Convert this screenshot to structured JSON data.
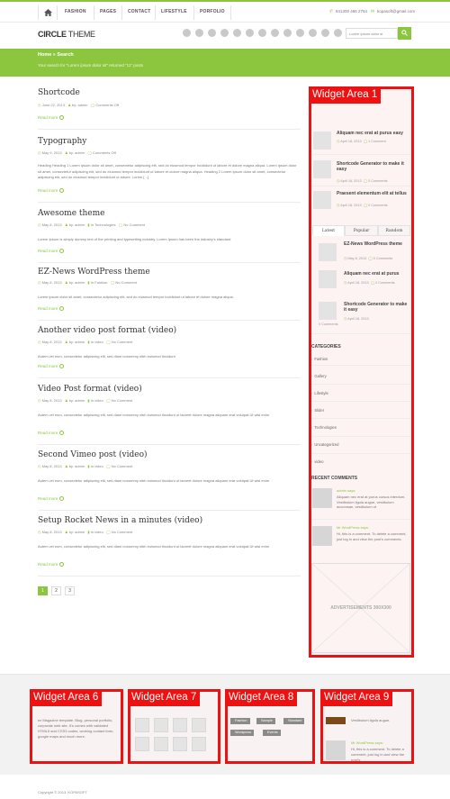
{
  "nav": {
    "menu": [
      "FASHION",
      "PAGES",
      "CONTACT",
      "LIFESTYLE",
      "PORFOLIO"
    ],
    "phone": "841300 466 2764",
    "email": "kopasoft@gmail.com"
  },
  "header": {
    "logo_bold": "CIRCLE",
    "logo_thin": " THEME",
    "search_placeholder": "Lorem ipsum dolor si"
  },
  "breadcrumb": {
    "path": "Home » Search",
    "result_text": "Your search for \"Lorem ipsum dolor sit\" returned \"11\" posts"
  },
  "posts": [
    {
      "title": "Shortcode",
      "date": "June 22, 2013",
      "author": "by: admin",
      "category": "",
      "comments": "Comments Off",
      "body": "",
      "more": "Read more"
    },
    {
      "title": "Typography",
      "date": "May 9, 2013",
      "author": "by: admin",
      "category": "",
      "comments": "Comments Off",
      "body": "Heading Heading 1 Lorem ipsum dolor sit amet, consectetur adipiscing elit, sed do eiusmod tempor incididunt ut labore et dolore magna aliqua. Lorem ipsum dolor sit amet, consectetur adipiscing elit, sed do eiusmod tempor incididunt ut labore et dolore magna aliqua. Heading 2 Lorem ipsum dolor sit amet, consectetur adipiscing elit, sed do eiusmod tempor incididunt ut labore. Lorem [...]",
      "more": "Read more"
    },
    {
      "title": "Awesome theme",
      "date": "May 8, 2013",
      "author": "by: admin",
      "category": "In Technologies",
      "comments": "No Comment",
      "body": "Lorem Ipsum is simply dummy text of the printing and typesetting industry. Lorem Ipsum has been the industry's standard",
      "more": "Read more"
    },
    {
      "title": "EZ-News WordPress theme",
      "date": "May 8, 2013",
      "author": "by: admin",
      "category": "In Fashion",
      "comments": "No Comment",
      "body": "Lorem ipsum dolor sit amet, consectetur adipiscing elit, sed do eiusmod tempor incididunt ut labore et dolore magna aliqua.",
      "more": "Read more"
    },
    {
      "title": "Another video post format (video)",
      "date": "May 8, 2013",
      "author": "by: admin",
      "category": "In video",
      "comments": "No Comment",
      "body": "Autem vel eum, consectetur adipiscing elit, sed diam nonummy nibh euismod tincidunt",
      "more": "Read more"
    },
    {
      "title": "Video Post format (video)",
      "date": "May 8, 2013",
      "author": "by: admin",
      "category": "In video",
      "comments": "No Comment",
      "body": "Autem vel eum, consectetur adipiscing elit, sed diam nonummy nibh euismod tincidunt ut laoreet dolore magna aliquam erat volutpat.Ut wisi enim",
      "more": "Read more"
    },
    {
      "title": "Second Vimeo post (video)",
      "date": "May 8, 2013",
      "author": "by: admin",
      "category": "In video",
      "comments": "No Comment",
      "body": "Autem vel eum, consectetur adipiscing elit, sed diam nonummy nibh euismod tincidunt ut laoreet dolore magna aliquam erat volutpat.Ut wisi enim",
      "more": "Read more"
    },
    {
      "title": "Setup Rocket News in a minutes (video)",
      "date": "May 8, 2013",
      "author": "by: admin",
      "category": "In video",
      "comments": "No Comment",
      "body": "Autem vel eum, consectetur adipiscing elit, sed diam nonummy nibh euismod tincidunt ut laoreet dolore magna aliquam erat volutpat.Ut wisi enim",
      "more": "Read more"
    }
  ],
  "pagination": [
    "1",
    "2",
    "3"
  ],
  "sidebar": {
    "label": "Widget Area 1",
    "top_posts": [
      {
        "title": "Aliquam nec erat at purus easy",
        "date": "April 18, 2013",
        "comments": "1 Comment"
      },
      {
        "title": "Shortcode Generator to make it easy",
        "date": "April 18, 2013",
        "comments": "0 Comments"
      },
      {
        "title": "Praesent elementum elit at tellus",
        "date": "April 18, 2013",
        "comments": "0 Comments"
      }
    ],
    "tabs": [
      "Latest",
      "Popular",
      "Random"
    ],
    "latest_posts": [
      {
        "title": "EZ-News WordPress theme",
        "date": "May 8, 2013",
        "comments": "0 Comments"
      },
      {
        "title": "Aliquam nec erat at purus",
        "date": "April 18, 2013",
        "comments": "0 Comments"
      },
      {
        "title": "Shortcode Generator to make it easy",
        "date": "April 18, 2013",
        "comments": "0 Comments"
      }
    ],
    "categories_heading": "CATEGORIES",
    "categories": [
      "Fashion",
      "Gallery",
      "Lifestyle",
      "Slider",
      "Technologies",
      "Uncategorized",
      "video"
    ],
    "recent_comments_heading": "RECENT COMMENTS",
    "recent_comments": [
      {
        "name": "admin says:",
        "text": "Aliquam nec erat at purus cursus interdum. Vestibulum ligula augue, vestibulum accumsan, vestibulum ut"
      },
      {
        "name": "Mr WordPress says:",
        "text": "Hi, this is a comment. To delete a comment, just log in and view the post's comments."
      }
    ],
    "ads": "ADVERTISEMENTS 300X300"
  },
  "footer": {
    "areas": [
      "Widget Area 6",
      "Widget Area 7",
      "Widget Area 8",
      "Widget Area 9"
    ],
    "about_text": "ez Magazine template. Blog, personal portfolio, corporate web site. It's comes with validated HTML5 and CSS3 codes, working contact form, google maps and much more.",
    "tags": [
      "Fashion",
      "Sample",
      "Standard",
      "Wordpress",
      "Events"
    ],
    "comment_text_1": "Vestibulum ligula augue.",
    "comment_name_2": "Mr WordPress says:",
    "comment_text_2": "Hi, this is a comment. To delete a comment, just log in and view the post's",
    "copyright": "Copyright © 2013. KOPASOFT"
  },
  "colors": {
    "accent": "#8cc63f",
    "widget_border": "#ee1111"
  }
}
